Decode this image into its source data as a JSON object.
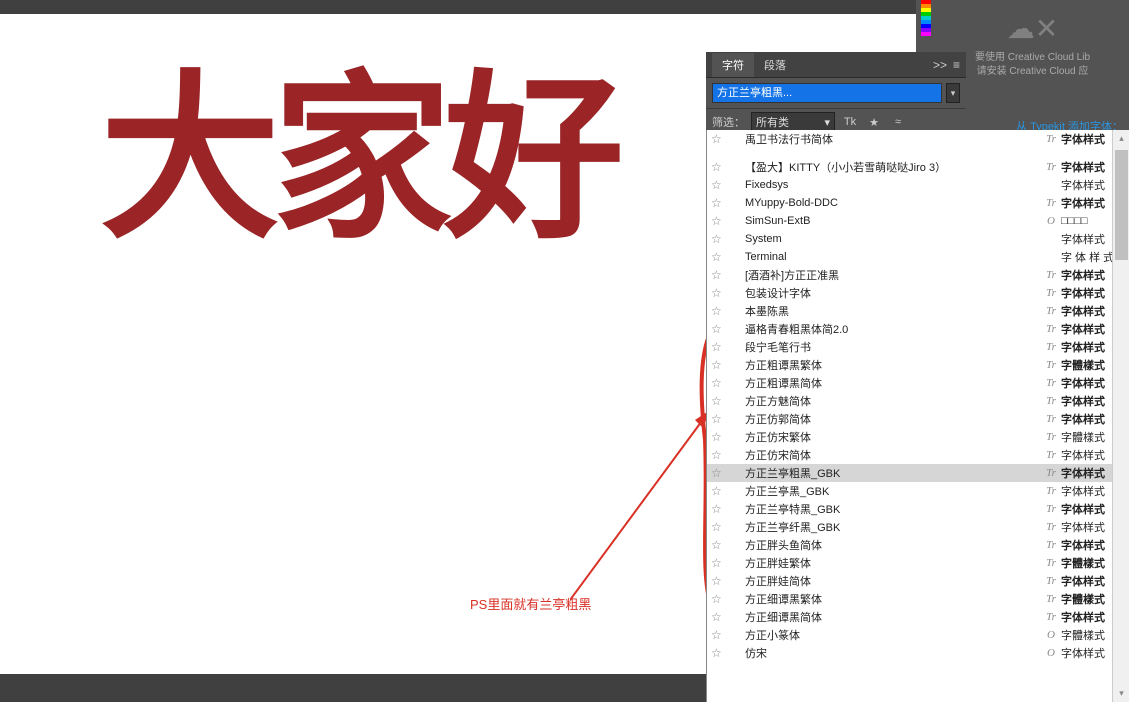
{
  "canvas": {
    "display_text": "大家好"
  },
  "annotation": {
    "text": "PS里面就有兰亭粗黑"
  },
  "panel": {
    "tab_char": "字符",
    "tab_para": "段落",
    "font_name": "方正兰亭粗黑...",
    "filter_label": "筛选：",
    "filter_value": "所有类",
    "tk_label": "Tk",
    "typekit_link": "从 Typekit 添加字体："
  },
  "cc": {
    "line1": "要使用 Creative Cloud Lib",
    "line2": "请安装 Creative Cloud 应"
  },
  "font_list": [
    {
      "name": "禹卫书法行书简体",
      "type": "Tr",
      "sample": "字体样式",
      "bold": true
    },
    {
      "name": "【盈大】KITTY（小小若雪萌哒哒Jiro 3）",
      "type": "Tr",
      "sample": "字体样式",
      "bold": true
    },
    {
      "name": "Fixedsys",
      "type": "",
      "sample": "字体样式",
      "bold": false
    },
    {
      "name": "MYuppy-Bold-DDC",
      "type": "Tr",
      "sample": "字体样式",
      "bold": true
    },
    {
      "name": "SimSun-ExtB",
      "type": "O",
      "sample": "□□□□",
      "bold": false
    },
    {
      "name": "System",
      "type": "",
      "sample": "字体样式",
      "bold": false
    },
    {
      "name": "Terminal",
      "type": "",
      "sample": "字 体 样 式",
      "bold": false
    },
    {
      "name": "[酒酒补]方正正准黑",
      "type": "Tr",
      "sample": "字体样式",
      "bold": true
    },
    {
      "name": "包装设计字体",
      "type": "Tr",
      "sample": "字体样式",
      "bold": true
    },
    {
      "name": "本墨陈黑",
      "type": "Tr",
      "sample": "字体样式",
      "bold": true
    },
    {
      "name": "逼格青春粗黑体简2.0",
      "type": "Tr",
      "sample": "字体样式",
      "bold": true
    },
    {
      "name": "段宁毛笔行书",
      "type": "Tr",
      "sample": "字体样式",
      "bold": true
    },
    {
      "name": "方正粗谭黑繁体",
      "type": "Tr",
      "sample": "字體樣式",
      "bold": true
    },
    {
      "name": "方正粗谭黑简体",
      "type": "Tr",
      "sample": "字体样式",
      "bold": true
    },
    {
      "name": "方正方魅简体",
      "type": "Tr",
      "sample": "字体样式",
      "bold": true
    },
    {
      "name": "方正仿郭简体",
      "type": "Tr",
      "sample": "字体样式",
      "bold": true
    },
    {
      "name": "方正仿宋繁体",
      "type": "Tr",
      "sample": "字體樣式",
      "bold": false
    },
    {
      "name": "方正仿宋简体",
      "type": "Tr",
      "sample": "字体样式",
      "bold": false
    },
    {
      "name": "方正兰亭粗黑_GBK",
      "type": "Tr",
      "sample": "字体样式",
      "bold": true,
      "selected": true
    },
    {
      "name": "方正兰亭黑_GBK",
      "type": "Tr",
      "sample": "字体样式",
      "bold": false
    },
    {
      "name": "方正兰亭特黑_GBK",
      "type": "Tr",
      "sample": "字体样式",
      "bold": true
    },
    {
      "name": "方正兰亭纤黑_GBK",
      "type": "Tr",
      "sample": "字体样式",
      "bold": false
    },
    {
      "name": "方正胖头鱼简体",
      "type": "Tr",
      "sample": "字体样式",
      "bold": true
    },
    {
      "name": "方正胖娃繁体",
      "type": "Tr",
      "sample": "字體樣式",
      "bold": true
    },
    {
      "name": "方正胖娃简体",
      "type": "Tr",
      "sample": "字体样式",
      "bold": true
    },
    {
      "name": "方正细谭黑繁体",
      "type": "Tr",
      "sample": "字體樣式",
      "bold": true
    },
    {
      "name": "方正细谭黑简体",
      "type": "Tr",
      "sample": "字体样式",
      "bold": true
    },
    {
      "name": "方正小篆体",
      "type": "O",
      "sample": "字體樣式",
      "bold": false
    },
    {
      "name": "仿宋",
      "type": "O",
      "sample": "字体样式",
      "bold": false
    }
  ]
}
